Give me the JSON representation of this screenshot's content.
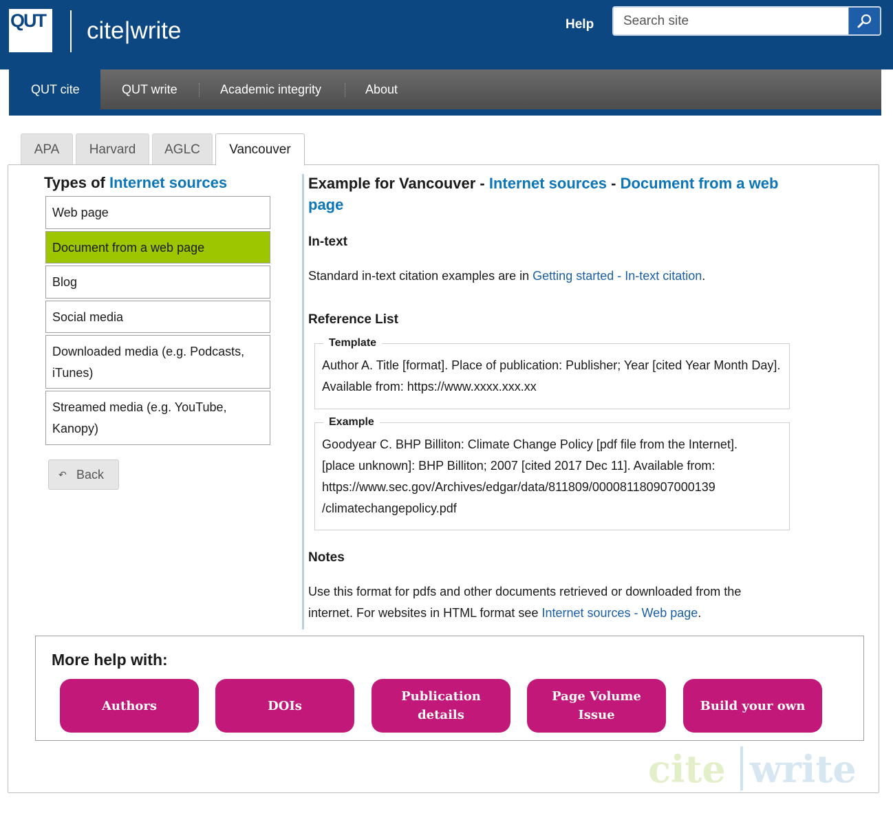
{
  "header": {
    "logo_text": "QUT",
    "site_title": "cite|write",
    "help_label": "Help",
    "search": {
      "placeholder": "Search site",
      "value": ""
    }
  },
  "nav": {
    "items": [
      {
        "label": "QUT cite",
        "active": true
      },
      {
        "label": "QUT write",
        "active": false
      },
      {
        "label": "Academic integrity",
        "active": false
      },
      {
        "label": "About",
        "active": false
      }
    ]
  },
  "tabs": [
    {
      "label": "APA",
      "active": false
    },
    {
      "label": "Harvard",
      "active": false
    },
    {
      "label": "AGLC",
      "active": false
    },
    {
      "label": "Vancouver",
      "active": true
    }
  ],
  "sidebar": {
    "heading_prefix": "Types of",
    "heading_link": "Internet sources",
    "items": [
      {
        "label": "Web page",
        "selected": false
      },
      {
        "label": "Document from a web page",
        "selected": true
      },
      {
        "label": "Blog",
        "selected": false
      },
      {
        "label": "Social media",
        "selected": false
      },
      {
        "label": "Downloaded media (e.g. Podcasts, iTunes)",
        "selected": false
      },
      {
        "label": "Streamed media (e.g. YouTube, Kanopy)",
        "selected": false
      }
    ],
    "back_label": "Back"
  },
  "main": {
    "heading_prefix": "Example for Vancouver - ",
    "heading_link1": "Internet sources",
    "heading_sep": " - ",
    "heading_link2": "Document from a web page",
    "intext": {
      "title": "In-text",
      "text_before": "Standard in-text citation examples are in ",
      "link": "Getting started - In-text citation",
      "text_after": "."
    },
    "reference_list": {
      "title": "Reference List",
      "template_legend": "Template",
      "template_text": "Author A. Title [format]. Place of publication: Publisher; Year [cited Year Month Day]. Available from: https://www.xxxx.xxx.xx",
      "example_legend": "Example",
      "example_line1": "Goodyear C. BHP Billiton: Climate Change Policy [pdf file from the Internet].",
      "example_line2": "[place unknown]: BHP Billiton; 2007 [cited 2017 Dec 11]. Available from:",
      "example_line3": "https://www.sec.gov/Archives/edgar/data/811809/000081180907000139",
      "example_line4": "/climatechangepolicy.pdf"
    },
    "notes": {
      "title": "Notes",
      "text_before": "Use this format for pdfs and other documents retrieved or downloaded from the internet. For websites in HTML format see ",
      "link": "Internet sources - Web page",
      "text_after": "."
    }
  },
  "more_help": {
    "title": "More help with:",
    "buttons": [
      "Authors",
      "DOIs",
      "Publication details",
      "Page Volume Issue",
      "Build your own"
    ]
  },
  "watermark": {
    "text_left": "cite",
    "text_right": "write"
  },
  "colors": {
    "brand_blue": "#0d4781",
    "link_blue": "#0b75b8",
    "selected_green": "#9ec600",
    "pill_magenta": "#c2187a",
    "nav_grey": "#5a5a5a"
  }
}
